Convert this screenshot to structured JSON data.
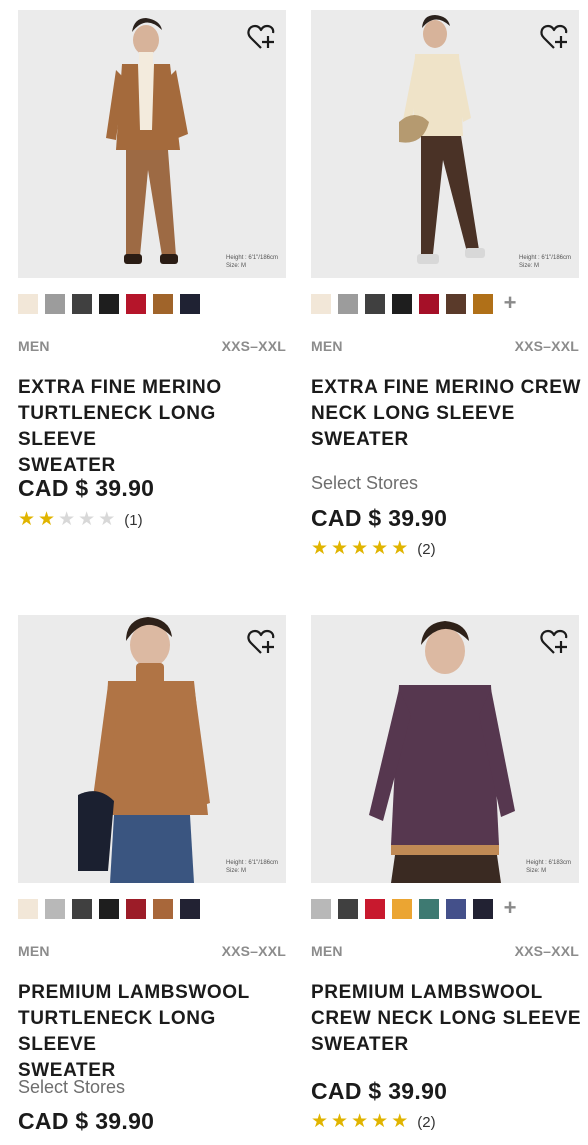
{
  "products": [
    {
      "gender": "MEN",
      "sizes": "XXS–XXL",
      "title_lines": [
        "EXTRA FINE MERINO",
        "TURTLENECK LONG SLEEVE",
        "SWEATER"
      ],
      "price": "CAD $ 39.90",
      "select_stores": "",
      "rating": 2,
      "review_count": "(1)",
      "size_note_lines": [
        "Height : 6'1\"/186cm",
        "Size: M"
      ],
      "swatches": [
        "#f2e7d8",
        "#9c9c9c",
        "#404040",
        "#1e1e1e",
        "#b5152a",
        "#a0642a",
        "#1f2233"
      ],
      "more_colors": false
    },
    {
      "gender": "MEN",
      "sizes": "XXS–XXL",
      "title_lines": [
        "EXTRA FINE MERINO CREW",
        "NECK LONG SLEEVE",
        "SWEATER"
      ],
      "price": "CAD $ 39.90",
      "select_stores": "Select Stores",
      "rating": 5,
      "review_count": "(2)",
      "size_note_lines": [
        "Height : 6'1\"/186cm",
        "Size: M"
      ],
      "swatches": [
        "#f2e7d8",
        "#9c9c9c",
        "#404040",
        "#1e1e1e",
        "#a51028",
        "#5a3a2a",
        "#b07018"
      ],
      "more_colors": true,
      "more_colors_label": "+"
    },
    {
      "gender": "MEN",
      "sizes": "XXS–XXL",
      "title_lines": [
        "PREMIUM LAMBSWOOL",
        "TURTLENECK LONG SLEEVE",
        "SWEATER"
      ],
      "price": "CAD $ 39.90",
      "select_stores": "Select Stores",
      "rating": 0,
      "review_count": "",
      "size_note_lines": [
        "Height : 6'1\"/186cm",
        "Size: M"
      ],
      "swatches": [
        "#f2e7d8",
        "#b8b8b8",
        "#404040",
        "#1e1e1e",
        "#9c1c28",
        "#a8673a",
        "#222233"
      ],
      "more_colors": false
    },
    {
      "gender": "MEN",
      "sizes": "XXS–XXL",
      "title_lines": [
        "PREMIUM LAMBSWOOL",
        "CREW NECK LONG SLEEVE",
        "SWEATER"
      ],
      "price": "CAD $ 39.90",
      "select_stores": "",
      "rating": 5,
      "review_count": "(2)",
      "size_note_lines": [
        "Height : 6'183cm",
        "Size: M"
      ],
      "swatches": [
        "#b8b8b8",
        "#404040",
        "#c8192e",
        "#eba532",
        "#3e7a72",
        "#44508a",
        "#222233"
      ],
      "more_colors": true,
      "more_colors_label": "+"
    }
  ],
  "icons": {
    "wishlist": "heart-plus-icon",
    "star": "star-icon",
    "more": "plus-icon"
  }
}
